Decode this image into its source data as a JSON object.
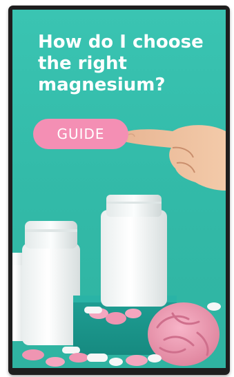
{
  "card": {
    "headline": "How do I choose the right magnesium?",
    "button_label": "GUIDE"
  },
  "icons": [
    "pointing-hand-illustration",
    "supplement-bottle",
    "brain-illustration",
    "pills"
  ],
  "colors": {
    "background": "#35bdab",
    "button": "#f48fb4",
    "text": "#ffffff"
  }
}
